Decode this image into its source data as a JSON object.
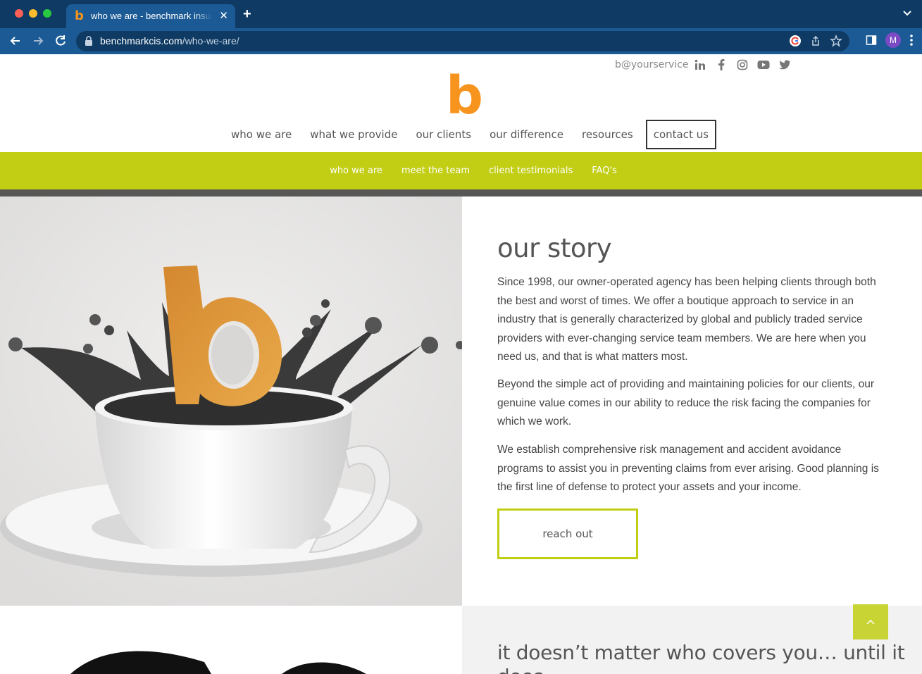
{
  "browser": {
    "tab_title": "who we are - benchmark insurance",
    "tab_favicon": "b",
    "url_domain": "benchmarkcis.com",
    "url_path": "/who-we-are/",
    "profile_initial": "M"
  },
  "header": {
    "contact_handle": "b@yourservice",
    "social_icons": [
      "linkedin-icon",
      "facebook-icon",
      "instagram-icon",
      "youtube-icon",
      "twitter-icon"
    ],
    "logo_letter": "b",
    "nav": [
      "who we are",
      "what we provide",
      "our clients",
      "our difference",
      "resources"
    ],
    "nav_cta": "contact us"
  },
  "subnav": [
    "who we are",
    "meet the team",
    "client testimonials",
    "FAQ's"
  ],
  "story": {
    "title": "our story",
    "paragraphs": [
      "Since 1998, our owner-operated agency has been helping clients through both the best and worst of times. We offer a boutique approach to service in an industry that is generally characterized by global and publicly traded service providers with ever-changing service team members. We are here when you need us, and that is what matters most.",
      "Beyond the simple act of providing and maintaining policies for our clients, our genuine value comes in our ability to reduce the risk facing the companies for which we work.",
      "We establish comprehensive risk management and accident avoidance programs to assist you in preventing claims from ever arising. Good planning is the first line of defense to protect your assets and your income."
    ],
    "button": "reach out"
  },
  "section2": {
    "title": "it doesn’t matter who covers you… until it does."
  },
  "colors": {
    "brand_orange": "#f7941d",
    "brand_lime": "#c1ce14",
    "chrome_dark": "#0f3a63",
    "chrome_mid": "#1b5a94"
  }
}
